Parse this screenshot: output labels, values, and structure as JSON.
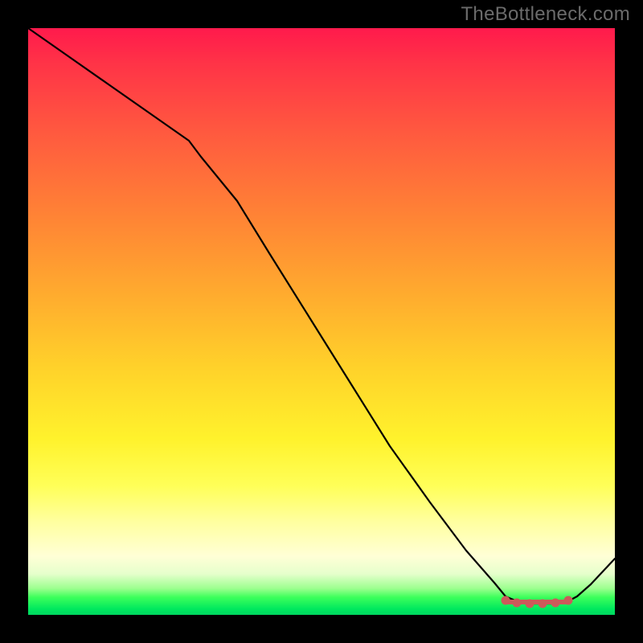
{
  "watermark": "TheBottleneck.com",
  "chart_data": {
    "type": "line",
    "title": "",
    "xlabel": "",
    "ylabel": "",
    "xlim": [
      0,
      100
    ],
    "ylim": [
      0,
      100
    ],
    "grid": false,
    "legend": false,
    "x": [
      0,
      5,
      10,
      15,
      20,
      25,
      30,
      35,
      40,
      45,
      50,
      55,
      60,
      65,
      70,
      75,
      80,
      82,
      84,
      86,
      88,
      90,
      92,
      95,
      100
    ],
    "values": [
      100,
      96,
      91,
      86,
      81,
      76,
      70,
      62,
      54,
      46,
      38,
      30,
      23,
      16,
      10,
      6,
      3,
      1.5,
      1,
      1,
      1,
      1,
      1.5,
      3,
      8
    ],
    "markers_x": [
      82,
      84,
      86,
      88,
      90,
      92
    ],
    "markers_y": [
      1.5,
      1,
      1,
      1,
      1,
      1.5
    ],
    "background_gradient": {
      "top": "#ff1a4c",
      "mid_upper": "#ffad2e",
      "mid_lower": "#fff22c",
      "bottom": "#00d660"
    }
  }
}
